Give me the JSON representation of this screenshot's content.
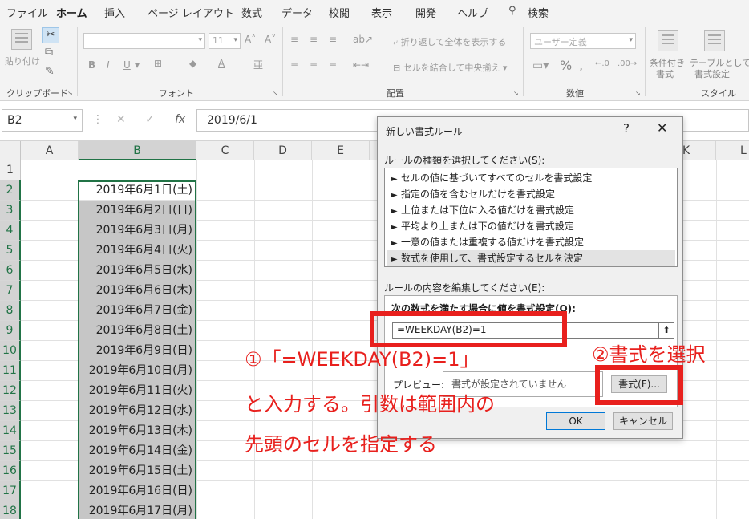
{
  "ribbon": {
    "tabs": [
      "ファイル",
      "ホーム",
      "挿入",
      "ページ レイアウト",
      "数式",
      "データ",
      "校閲",
      "表示",
      "開発",
      "ヘルプ",
      "検索"
    ],
    "groups": [
      "クリップボード",
      "フォント",
      "配置",
      "数値",
      "スタイル"
    ],
    "paste": "貼り付け",
    "font_size": "11",
    "number_format": "ユーザー定義",
    "wrap_text": "折り返して全体を表示する",
    "merge_center": "セルを結合して中央揃え",
    "cond_format": [
      "条件付き",
      "書式"
    ],
    "table_format": [
      "テーブルとして",
      "書式設定"
    ]
  },
  "formula_bar": {
    "name_box": "B2",
    "formula": "2019/6/1"
  },
  "sheet": {
    "columns": [
      "A",
      "B",
      "C",
      "D",
      "E",
      "K",
      "L"
    ],
    "rows": [
      "1",
      "2",
      "3",
      "4",
      "5",
      "6",
      "7",
      "8",
      "9",
      "10",
      "11",
      "12",
      "13",
      "14",
      "15",
      "16",
      "17",
      "18"
    ],
    "dates": [
      "2019年6月1日(土)",
      "2019年6月2日(日)",
      "2019年6月3日(月)",
      "2019年6月4日(火)",
      "2019年6月5日(水)",
      "2019年6月6日(木)",
      "2019年6月7日(金)",
      "2019年6月8日(土)",
      "2019年6月9日(日)",
      "2019年6月10日(月)",
      "2019年6月11日(火)",
      "2019年6月12日(水)",
      "2019年6月13日(木)",
      "2019年6月14日(金)",
      "2019年6月15日(土)",
      "2019年6月16日(日)",
      "2019年6月17日(月)"
    ]
  },
  "dialog": {
    "title": "新しい書式ルール",
    "help": "?",
    "close": "✕",
    "rule_type_label": "ルールの種類を選択してください(S):",
    "rules": [
      "セルの値に基づいてすべてのセルを書式設定",
      "指定の値を含むセルだけを書式設定",
      "上位または下位に入る値だけを書式設定",
      "平均より上または下の値だけを書式設定",
      "一意の値または重複する値だけを書式設定",
      "数式を使用して、書式設定するセルを決定"
    ],
    "edit_label": "ルールの内容を編集してください(E):",
    "condition_label": "次の数式を満たす場合に値を書式設定(O):",
    "formula_value": "=WEEKDAY(B2)=1",
    "preview_label": "プレビュー:",
    "preview_text": "書式が設定されていません",
    "format_button": "書式(F)...",
    "ok_button": "OK",
    "cancel_button": "キャンセル"
  },
  "annotations": {
    "step1": "①「=WEEKDAY(B2)=1」",
    "step1_line2": "と入力する。引数は範囲内の",
    "step1_line3": "先頭のセルを指定する",
    "step2": "②書式を選択",
    "color": "#e8201d"
  }
}
